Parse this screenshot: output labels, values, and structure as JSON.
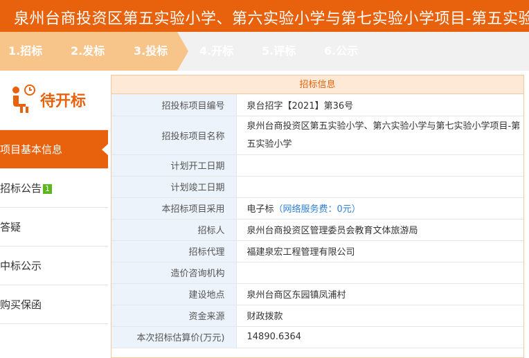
{
  "title": "泉州台商投资区第五实验小学、第六实验小学与第七实验小学项目-第五实验",
  "steps": [
    "1.招标",
    "2.发标",
    "3.投标",
    "4.开标",
    "5.评标",
    "6.公示"
  ],
  "status_label": "待开标",
  "nav": {
    "items": [
      "项目基本信息",
      "招标公告",
      "答疑",
      "中标公示",
      "购买保函"
    ],
    "badge": "1"
  },
  "panel": {
    "heading": "招标信息",
    "rows": [
      {
        "key": "招投标项目编号",
        "value": "泉台招字【2021】第36号"
      },
      {
        "key": "招投标项目名称",
        "value": "泉州台商投资区第五实验小学、第六实验小学与第七实验小学项目-第五实验小学"
      },
      {
        "key": "计划开工日期",
        "value": ""
      },
      {
        "key": "计划竣工日期",
        "value": ""
      },
      {
        "key": "本招标项目采用",
        "value": "电子标",
        "note": "（网络服务费：0元）"
      },
      {
        "key": "招标人",
        "value": "泉州台商投资区管理委员会教育文体旅游局"
      },
      {
        "key": "招标代理",
        "value": "福建泉宏工程管理有限公司"
      },
      {
        "key": "造价咨询机构",
        "value": ""
      },
      {
        "key": "建设地点",
        "value": "泉州台商区东园镇凤浦村"
      },
      {
        "key": "资金来源",
        "value": "财政拨款"
      },
      {
        "key": "本次招标估算价(万元)",
        "value": "14890.6364"
      }
    ]
  },
  "colors": {
    "brand": "#e8620d",
    "step_done": "#f7c48a",
    "badge": "#5db51f",
    "link": "#2f7fd4"
  },
  "icons": {
    "status": "person-seated-clock-icon"
  }
}
